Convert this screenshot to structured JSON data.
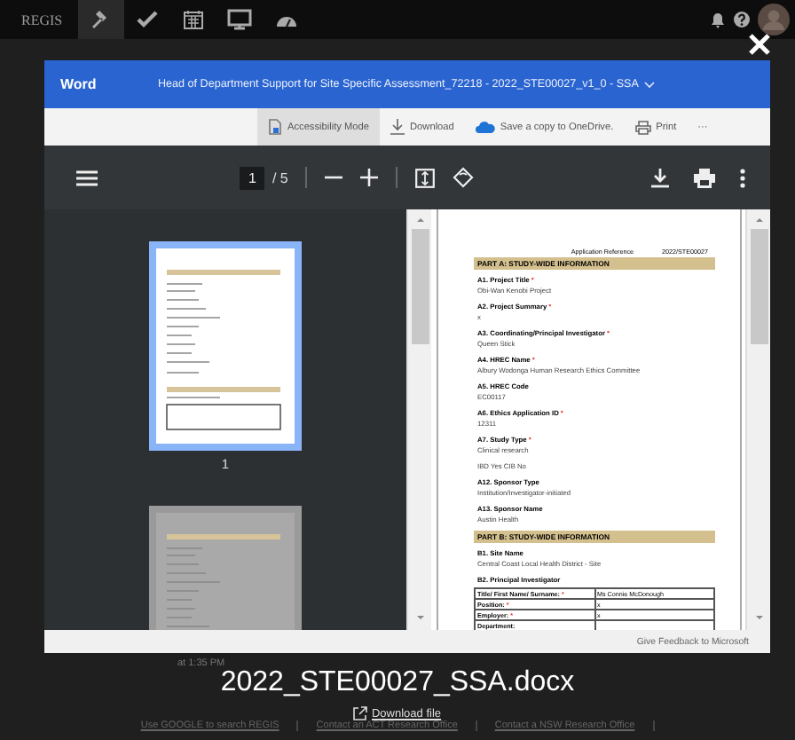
{
  "nav": {
    "logo": "REGIS",
    "items": [
      {
        "kind": "gavel",
        "selected": true
      },
      {
        "kind": "check",
        "selected": false
      },
      {
        "kind": "calendar",
        "selected": false
      },
      {
        "kind": "monitor",
        "selected": false
      },
      {
        "kind": "gauge",
        "selected": false
      }
    ]
  },
  "viewer": {
    "app": "Word",
    "title": "Head of Department Support for Site Specific Assessment_72218 - 2022_STE00027_v1_0 - SSA",
    "toolbar": [
      {
        "kind": "accessibility",
        "label": "Accessibility Mode",
        "selected": true
      },
      {
        "kind": "download",
        "label": "Download",
        "selected": false
      },
      {
        "kind": "onedrive",
        "label": "Save a copy to OneDrive.",
        "selected": false
      },
      {
        "kind": "print",
        "label": "Print",
        "selected": false
      },
      {
        "kind": "more",
        "label": "···",
        "selected": false
      }
    ],
    "page": "1",
    "page_total": "/ 5",
    "thumbnails": [
      {
        "label": "1",
        "selected": true
      },
      {
        "selected": false
      }
    ],
    "document": {
      "reference_label": "Application Reference",
      "reference": "2022/STE00027",
      "blocks": [
        {
          "kind": "section",
          "text": "PART A: STUDY-WIDE INFORMATION"
        },
        {
          "kind": "field",
          "label": "A1. Project Title",
          "mark": "*",
          "value": "Obi-Wan Kenobi Project"
        },
        {
          "kind": "field",
          "label": "A2. Project Summary",
          "mark": "*",
          "value": "x"
        },
        {
          "kind": "field",
          "label": "A3. Coordinating/Principal Investigator",
          "mark": "*",
          "value": "Queen Stick"
        },
        {
          "kind": "field",
          "label": "A4. HREC Name",
          "mark": "*",
          "value": "Albury Wodonga Human Research Ethics Committee"
        },
        {
          "kind": "field",
          "label": "A5. HREC Code",
          "value": "EC00117"
        },
        {
          "kind": "field",
          "label": "A6. Ethics Application ID",
          "mark": "*",
          "value": "12311"
        },
        {
          "kind": "field",
          "label": "A7. Study Type",
          "mark": "*",
          "value": "Clinical research"
        },
        {
          "kind": "plain",
          "text": "IBD Yes    CIB No"
        },
        {
          "kind": "field",
          "label": "A12. Sponsor Type",
          "value": "Institution/Investigator-initiated"
        },
        {
          "kind": "field",
          "label": "A13. Sponsor Name",
          "value": "Austin Health"
        },
        {
          "kind": "section",
          "text": "PART B: STUDY-WIDE INFORMATION"
        },
        {
          "kind": "field",
          "label": "B1. Site Name",
          "value": "Central Coast Local Health District - Site"
        },
        {
          "kind": "heading",
          "text": "B2. Principal Investigator"
        },
        {
          "kind": "table",
          "rows": [
            {
              "label": "Title/ First Name/ Surname:",
              "mark": "*",
              "value": "Ms Connie McDonough"
            },
            {
              "label": "Position:",
              "mark": "*",
              "value": "x"
            },
            {
              "label": "Employer:",
              "mark": "*",
              "value": "x"
            },
            {
              "label": "Department:"
            }
          ]
        }
      ]
    },
    "feedback": "Give Feedback to Microsoft"
  },
  "file_name": "2022_STE00027_SSA.docx",
  "download": "Download file",
  "background": {
    "time": "at 1:35 PM",
    "footer_links": [
      "Use GOOGLE to search REGIS",
      "Contact an ACT Research Office",
      "Contact a NSW Research Office"
    ]
  }
}
